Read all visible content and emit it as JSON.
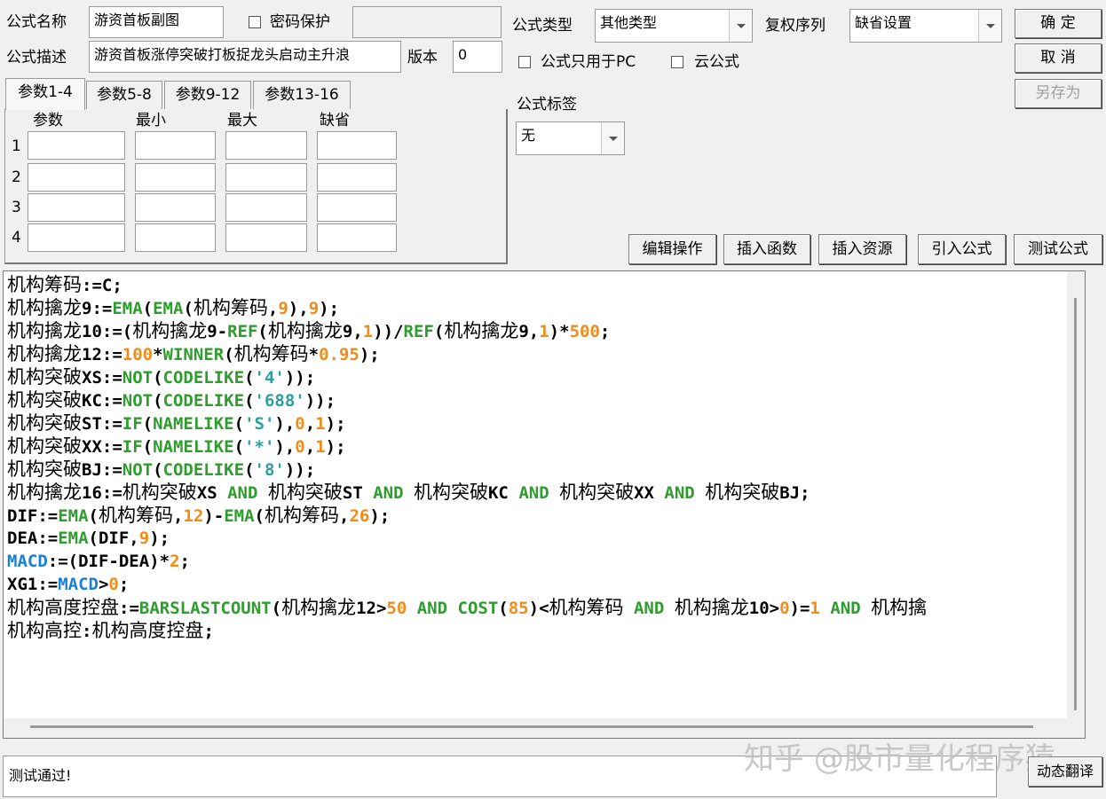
{
  "form": {
    "name_label": "公式名称",
    "name_value": "游资首板副图",
    "password_label": "密码保护",
    "password_value": "",
    "desc_label": "公式描述",
    "desc_value": "游资首板涨停突破打板捉龙头启动主升浪",
    "version_label": "版本",
    "version_value": "0",
    "type_label": "公式类型",
    "type_value": "其他类型",
    "rights_label": "复权序列",
    "rights_value": "缺省设置",
    "pc_only_label": "公式只用于PC",
    "cloud_label": "云公式",
    "tag_label": "公式标签",
    "tag_value": "无"
  },
  "buttons": {
    "ok": "确 定",
    "cancel": "取 消",
    "save_as": "另存为",
    "edit_ops": "编辑操作",
    "insert_func": "插入函数",
    "insert_res": "插入资源",
    "import_formula": "引入公式",
    "test_formula": "测试公式",
    "dynamic_translate": "动态翻译"
  },
  "tabs": [
    "参数1-4",
    "参数5-8",
    "参数9-12",
    "参数13-16"
  ],
  "params": {
    "headers": [
      "参数",
      "最小",
      "最大",
      "缺省"
    ],
    "rows": [
      "1",
      "2",
      "3",
      "4"
    ]
  },
  "code_lines": [
    "机构筹码:=C;",
    "机构擒龙9:=EMA(EMA(机构筹码,9),9);",
    "机构擒龙10:=(机构擒龙9-REF(机构擒龙9,1))/REF(机构擒龙9,1)*500;",
    "机构擒龙12:=100*WINNER(机构筹码*0.95);",
    "机构突破XS:=NOT(CODELIKE('4'));",
    "机构突破KC:=NOT(CODELIKE('688'));",
    "机构突破ST:=IF(NAMELIKE('S'),0,1);",
    "机构突破XX:=IF(NAMELIKE('*'),0,1);",
    "机构突破BJ:=NOT(CODELIKE('8'));",
    "机构擒龙16:=机构突破XS AND 机构突破ST AND 机构突破KC AND 机构突破XX AND 机构突破BJ;",
    "DIF:=EMA(机构筹码,12)-EMA(机构筹码,26);",
    "DEA:=EMA(DIF,9);",
    "MACD:=(DIF-DEA)*2;",
    "XG1:=MACD>0;",
    "机构高度控盘:=BARSLASTCOUNT(机构擒龙12>50 AND COST(85)<机构筹码 AND 机构擒龙10>0)=1 AND 机构擒",
    "机构高控:机构高度控盘;"
  ],
  "status_text": "测试通过!",
  "watermark": "知乎 @股市量化程序猿",
  "colors": {
    "function": "#2e9d2e",
    "number": "#f08c1a",
    "string": "#2aa0a0",
    "variable": "#1a7fd6"
  }
}
